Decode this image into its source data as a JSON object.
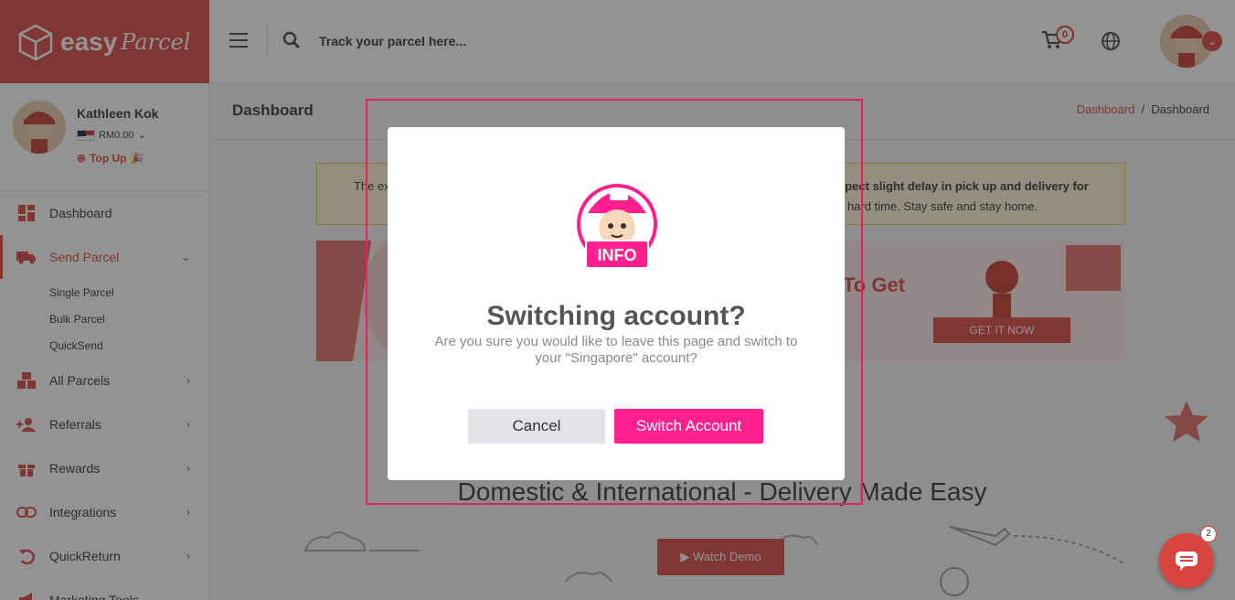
{
  "brand": {
    "name": "easy",
    "script": "Parcel"
  },
  "header": {
    "search_placeholder": "Track your parcel here...",
    "cart_count": "0"
  },
  "profile": {
    "name": "Kathleen Kok",
    "balance": "RM0.00",
    "topup": "Top Up"
  },
  "sidebar": {
    "items": [
      {
        "label": "Dashboard"
      },
      {
        "label": "Send Parcel",
        "sub": [
          "Single Parcel",
          "Bulk Parcel",
          "QuickSend"
        ]
      },
      {
        "label": "All Parcels"
      },
      {
        "label": "Referrals"
      },
      {
        "label": "Rewards"
      },
      {
        "label": "Integrations"
      },
      {
        "label": "QuickReturn"
      },
      {
        "label": "Marketing Tools"
      }
    ]
  },
  "main": {
    "title": "Dashboard",
    "breadcrumb": [
      "Dashboard",
      "Dashboard"
    ],
    "notice_right_1": "xpect slight delay in pick up and delivery for",
    "notice_right_2": "hard time. Stay safe and stay home.",
    "notice_left": "The ex",
    "banner_text": "To Get",
    "banner_cta": "GET IT NOW",
    "tagline": "Domestic & International - Delivery Made Easy",
    "watch_demo": "Watch Demo"
  },
  "modal": {
    "mascot_label": "INFO",
    "title": "Switching account?",
    "message": "Are you sure you would like to leave this page and switch to your \"Singapore\" account?",
    "cancel": "Cancel",
    "confirm": "Switch Account"
  },
  "chat": {
    "badge": "2"
  },
  "colors": {
    "brand": "#d8453f",
    "accent": "#ff1f8e",
    "highlight": "#e0245e"
  }
}
